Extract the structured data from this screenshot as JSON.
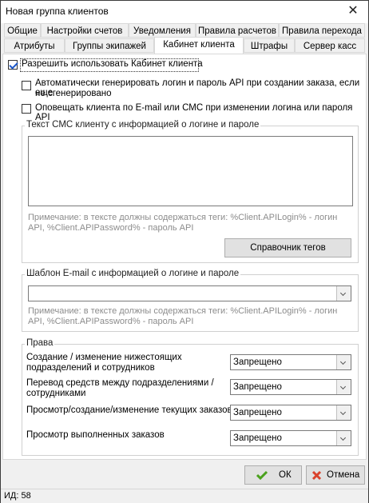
{
  "window": {
    "title": "Новая группа клиентов"
  },
  "tabs_row1": [
    "Общие",
    "Настройки счетов",
    "Уведомления",
    "Правила расчетов",
    "Правила перехода"
  ],
  "tabs_row2": [
    "Атрибуты",
    "Группы экипажей",
    "Кабинет клиента",
    "Штрафы",
    "Сервер касс"
  ],
  "active_tab": "Кабинет клиента",
  "allow_cabinet": {
    "label": "Разрешить использовать Кабинет клиента",
    "checked": true
  },
  "auto_generate": {
    "line1": "Автоматически генерировать логин и пароль API при создании заказа, если еще",
    "line2": "не сгенерировано",
    "checked": false
  },
  "notify_client": {
    "label": "Оповещать клиента по E-mail или СМС при изменении логина или пароля API",
    "checked": false
  },
  "sms_group": {
    "title": "Текст СМС клиенту с информацией о логине и пароле",
    "value": "",
    "note_line1": "Примечание: в тексте должны содержаться теги: %Client.APILogin% - логин",
    "note_line2": "API, %Client.APIPassword% - пароль API",
    "tags_button": "Справочник тегов"
  },
  "email_group": {
    "title": "Шаблон E-mail с информацией о логине и пароле",
    "value": "",
    "note_line1": "Примечание: в тексте должны содержаться теги: %Client.APILogin% - логин",
    "note_line2": "API, %Client.APIPassword% - пароль API"
  },
  "rights": {
    "title": "Права",
    "items": [
      {
        "line1": "Создание / изменение нижестоящих",
        "line2": "подразделений и сотрудников",
        "value": "Запрещено"
      },
      {
        "line1": "Перевод средств между подразделениями /",
        "line2": "сотрудниками",
        "value": "Запрещено"
      },
      {
        "line1": "Просмотр/создание/изменение текущих заказов",
        "line2": "",
        "value": "Запрещено"
      },
      {
        "line1": "Просмотр выполненных заказов",
        "line2": "",
        "value": "Запрещено"
      }
    ]
  },
  "buttons": {
    "ok": "ОК",
    "cancel": "Отмена"
  },
  "status": {
    "id_text": "ИД: 58"
  },
  "colors": {
    "check": "#1a56c8",
    "ok_icon": "#4aa11c",
    "cancel_icon": "#d9412b",
    "note": "#8c8c8c"
  }
}
